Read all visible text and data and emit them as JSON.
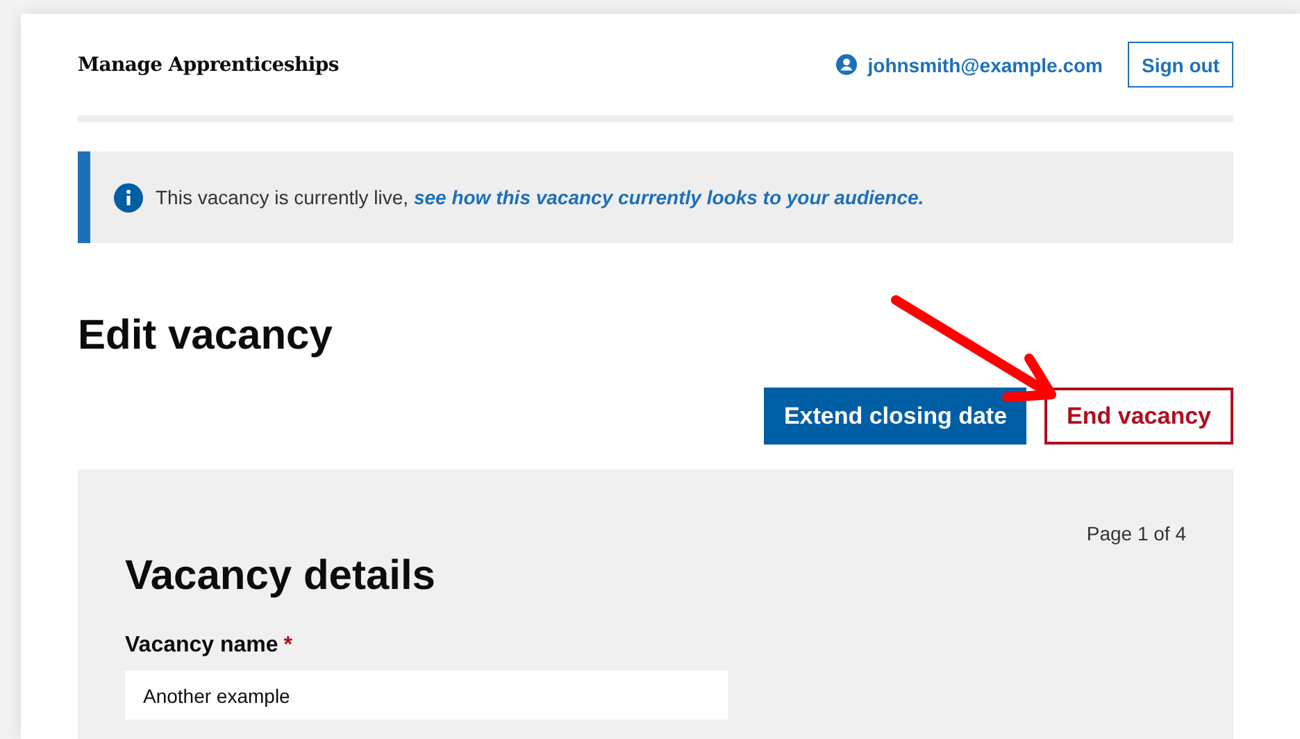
{
  "header": {
    "service_name": "Manage Apprenticeships",
    "account_email": "johnsmith@example.com",
    "sign_out": "Sign out"
  },
  "banner": {
    "text": "This vacancy is currently live, ",
    "link": "see how this vacancy currently looks to your audience."
  },
  "page_title": "Edit vacancy",
  "actions": [
    {
      "label": "Extend closing date",
      "kind": "primary"
    },
    {
      "label": "End vacancy",
      "kind": "warning"
    }
  ],
  "form": {
    "page_indicator": "Page 1 of 4",
    "title": "Vacancy details",
    "fields": [
      {
        "label": "Vacancy name",
        "required_mark": "*",
        "value": "Another example"
      }
    ]
  }
}
